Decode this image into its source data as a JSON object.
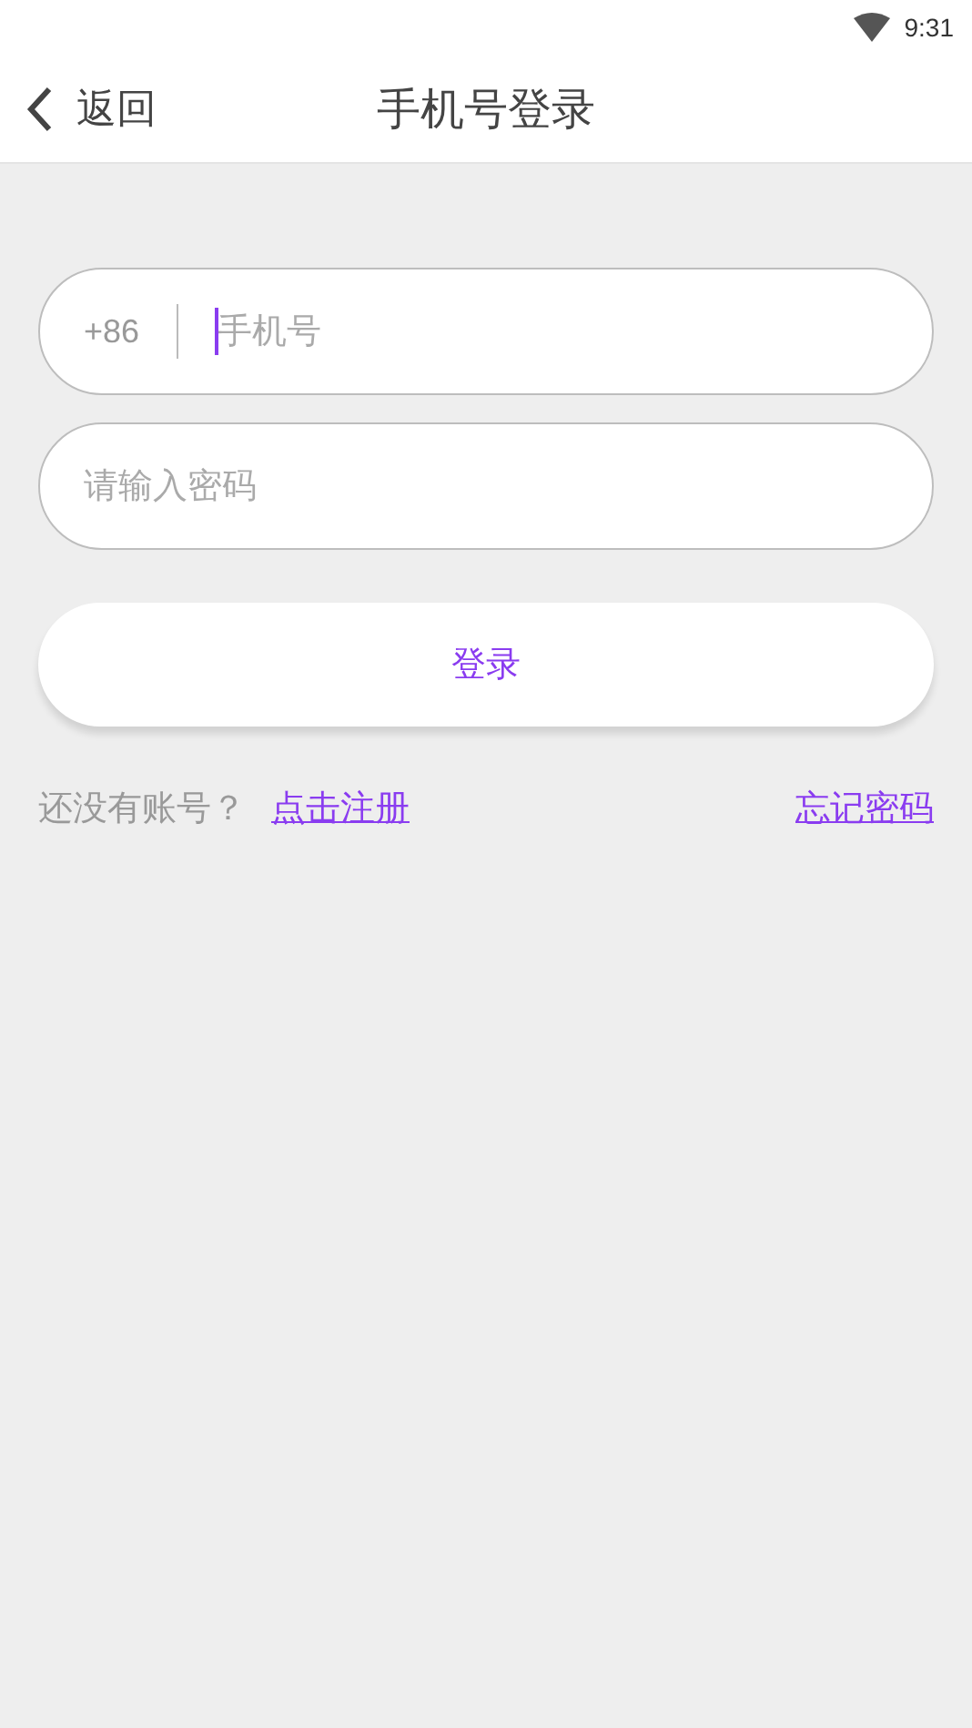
{
  "status_bar": {
    "time": "9:31"
  },
  "header": {
    "back_label": "返回",
    "title": "手机号登录"
  },
  "phone_field": {
    "prefix": "+86",
    "placeholder": "手机号",
    "focused": true
  },
  "password_field": {
    "placeholder": "请输入密码"
  },
  "login_button": {
    "label": "登录"
  },
  "footer": {
    "prompt": "还没有账号？",
    "register_link": "点击注册",
    "forgot_link": "忘记密码"
  }
}
